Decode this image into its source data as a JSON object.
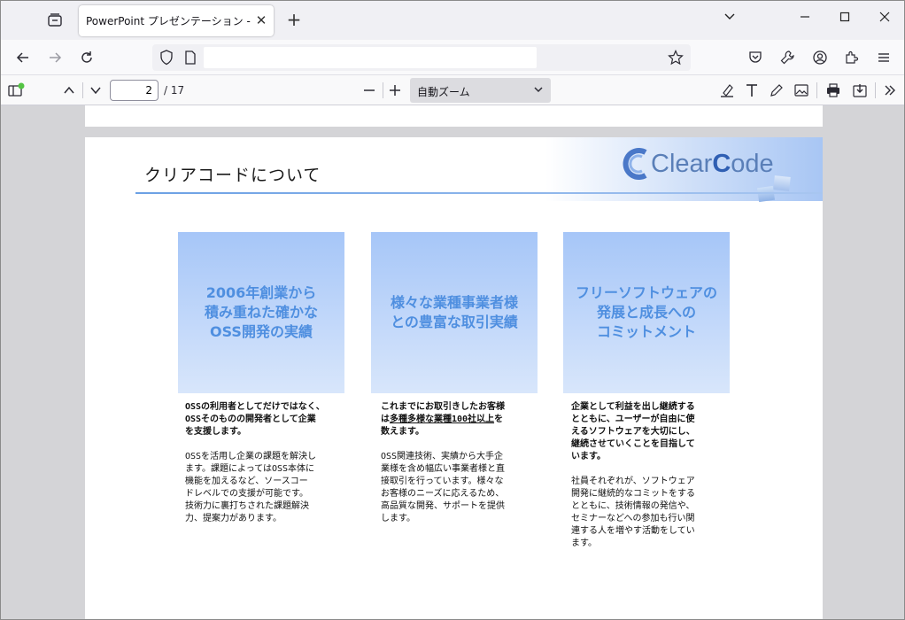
{
  "browser": {
    "tab_title": "PowerPoint プレゼンテーション - clear-",
    "url_value": "",
    "accent": "#2b2a33"
  },
  "pdf_toolbar": {
    "page_value": "2",
    "page_count": "/ 17",
    "zoom_label": "自動ズーム"
  },
  "slide": {
    "title": "クリアコードについて",
    "logo_text_1": "Clear",
    "logo_text_2": "C",
    "logo_text_3": "ode",
    "cards": [
      {
        "label": "2006年創業から\n積み重ねた確かな\nOSS開発の実績"
      },
      {
        "label": "様々な業種事業者様\nとの豊富な取引実績"
      },
      {
        "label": "フリーソフトウェアの\n発展と成長への\nコミットメント"
      }
    ],
    "columns": [
      {
        "lead": "OSSの利用者としてだけではなく、\nOSSそのものの開発者として企業\nを支援します。",
        "body": "OSSを活用し企業の課題を解決し\nます。課題によってはOSS本体に\n機能を加えるなど、ソースコー\nドレベルでの支援が可能です。\n技術力に裏打ちされた課題解決\n力、提案力があります。"
      },
      {
        "lead_1": "これまでにお取引きしたお客様\nは",
        "lead_underlined": "多種多様な業種100社以上",
        "lead_2": "を\n数えます。",
        "body": "OSS関連技術、実績から大手企\n業様を含め幅広い事業者様と直\n接取引を行っています。様々な\nお客様のニーズに応えるため、\n高品質な開発、サポートを提供\nします。"
      },
      {
        "lead": "企業として利益を出し継続する\nとともに、ユーザーが自由に使\nえるソフトウェアを大切にし、\n継続させていくことを目指して\nいます。",
        "body": "社員それぞれが、ソフトウェア\n開発に継続的なコミットをする\nとともに、技術情報の発信や、\nセミナーなどへの参加も行い関\n連する人を増やす活動をしてい\nます。"
      }
    ]
  }
}
